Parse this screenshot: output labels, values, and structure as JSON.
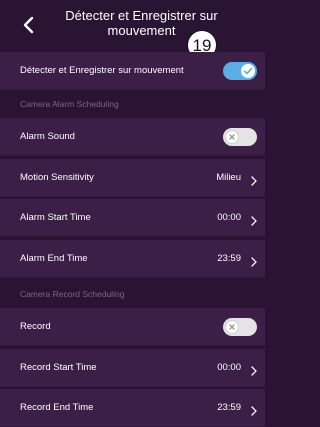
{
  "header": {
    "title": "Détecter et Enregistrer sur mouvement",
    "badge": "19"
  },
  "colors": {
    "background": "#2a1433",
    "row": "#3b1f46",
    "section_text": "#7d6585",
    "toggle_on": "#5aaee3",
    "toggle_off": "#e4e4e4"
  },
  "rows": {
    "detect": {
      "label": "Détecter et Enregistrer sur mouvement",
      "toggle": "on"
    },
    "alarm_section": {
      "label": "Camera Alarm Scheduling"
    },
    "alarm_sound": {
      "label": "Alarm Sound",
      "toggle": "off"
    },
    "motion_sensitivity": {
      "label": "Motion Sensitivity",
      "value": "Milieu"
    },
    "alarm_start": {
      "label": "Alarm Start Time",
      "value": "00:00"
    },
    "alarm_end": {
      "label": "Alarm End Time",
      "value": "23:59"
    },
    "record_section": {
      "label": "Camera Record Scheduling"
    },
    "record": {
      "label": "Record",
      "toggle": "off"
    },
    "record_start": {
      "label": "Record Start Time",
      "value": "00:00"
    },
    "record_end": {
      "label": "Record End Time",
      "value": "23:59"
    }
  },
  "icons": {
    "back": "chevron-left-icon",
    "chevron": "chevron-right-icon",
    "check": "check-icon",
    "x": "x-icon"
  }
}
